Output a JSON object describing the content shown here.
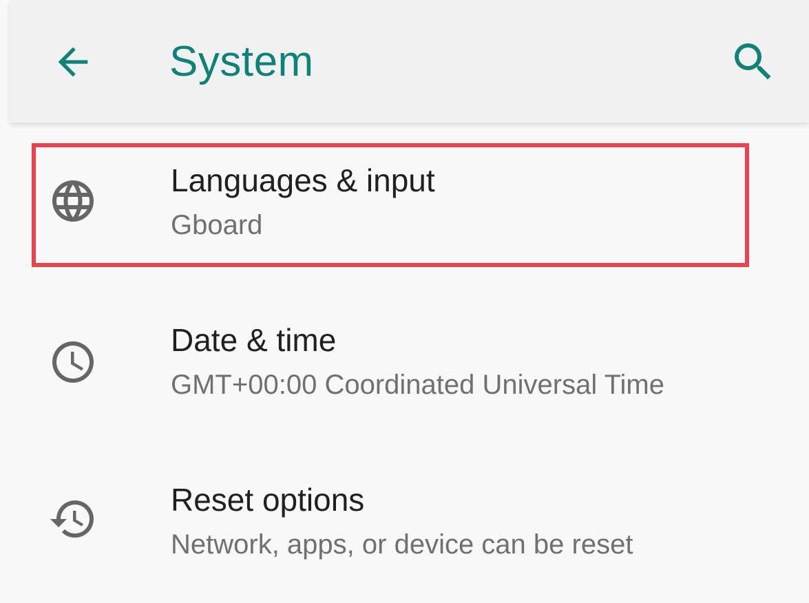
{
  "header": {
    "title": "System",
    "back_icon": "arrow-back-icon",
    "search_icon": "search-icon",
    "accent_color": "#0d8277"
  },
  "items": [
    {
      "label": "Languages & input",
      "summary": "Gboard",
      "icon": "globe-icon"
    },
    {
      "label": "Date & time",
      "summary": "GMT+00:00 Coordinated Universal Time",
      "icon": "clock-icon"
    },
    {
      "label": "Reset options",
      "summary": "Network, apps, or device can be reset",
      "icon": "history-icon"
    }
  ],
  "highlight_color": "#e8434f"
}
